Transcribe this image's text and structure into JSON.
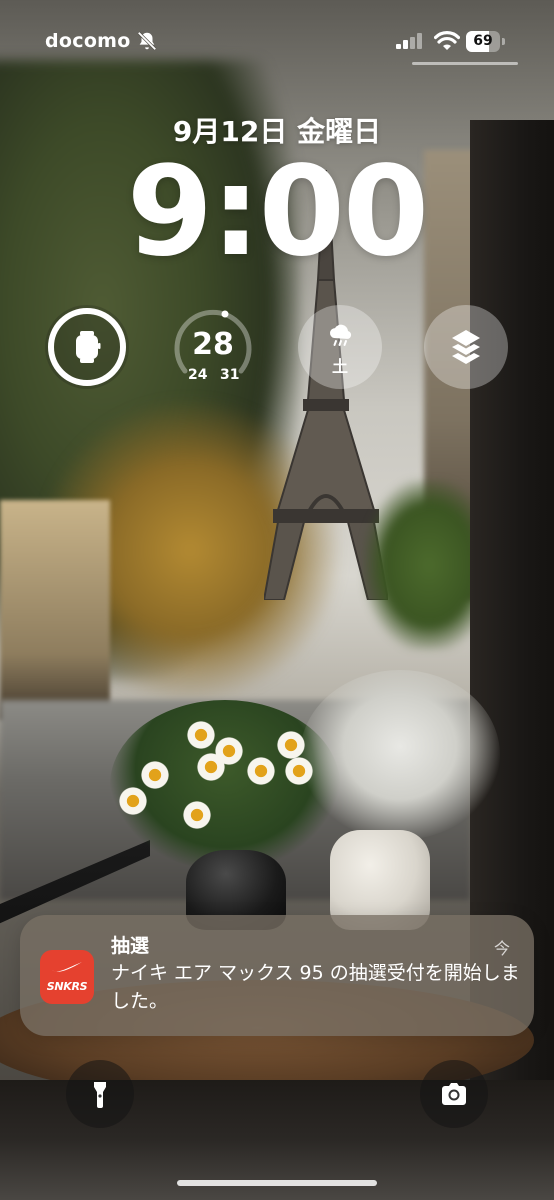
{
  "status_bar": {
    "carrier": "docomo",
    "battery_level": "69",
    "battery_fraction": 0.69
  },
  "clock": {
    "date": "9月12日 金曜日",
    "time": "9:00"
  },
  "widgets": {
    "temperature": {
      "current": "28",
      "low": "24",
      "high": "31"
    },
    "weather": {
      "icon": "cloud-rain-icon",
      "day": "土"
    },
    "watch": {
      "icon": "apple-watch-icon"
    },
    "shortcut": {
      "icon": "layers-icon"
    }
  },
  "notification": {
    "app_icon_label": "SNKRS",
    "title": "抽選",
    "time": "今",
    "body": "ナイキ エア マックス 95 の抽選受付を開始しました。"
  },
  "controls": {
    "left_icon": "flashlight-icon",
    "right_icon": "camera-icon"
  },
  "colors": {
    "app_icon_bg": "#e5412f",
    "notification_bg": "#78706a"
  }
}
